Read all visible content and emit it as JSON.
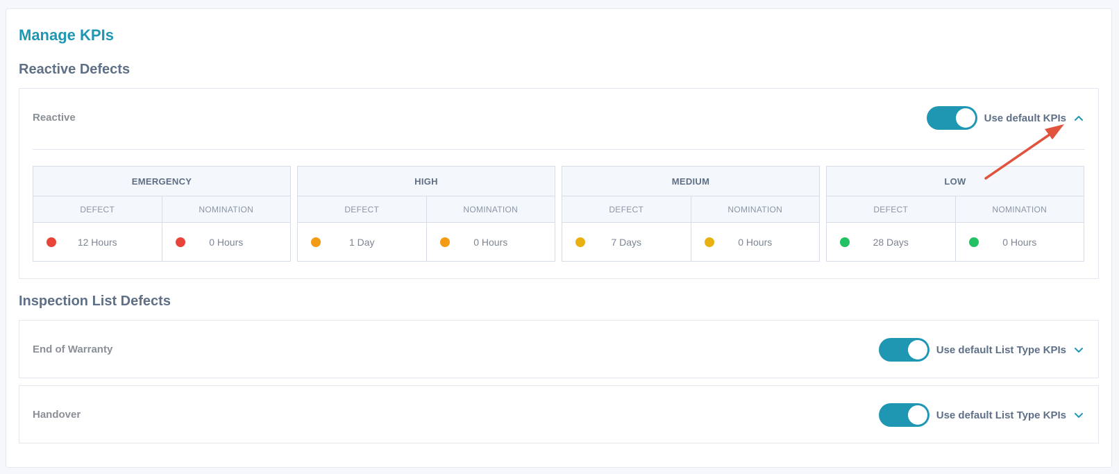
{
  "page": {
    "title": "Manage KPIs"
  },
  "reactive_section": {
    "title": "Reactive Defects",
    "panel": {
      "label": "Reactive",
      "toggle_on": true,
      "toggle_label": "Use default KPIs",
      "expanded": true,
      "groups": [
        {
          "name": "EMERGENCY",
          "defect_header": "DEFECT",
          "nomination_header": "NOMINATION",
          "defect_value": "12 Hours",
          "nomination_value": "0 Hours",
          "color": "#e8443a"
        },
        {
          "name": "HIGH",
          "defect_header": "DEFECT",
          "nomination_header": "NOMINATION",
          "defect_value": "1 Day",
          "nomination_value": "0 Hours",
          "color": "#f39b14"
        },
        {
          "name": "MEDIUM",
          "defect_header": "DEFECT",
          "nomination_header": "NOMINATION",
          "defect_value": "7 Days",
          "nomination_value": "0 Hours",
          "color": "#e8b10f"
        },
        {
          "name": "LOW",
          "defect_header": "DEFECT",
          "nomination_header": "NOMINATION",
          "defect_value": "28 Days",
          "nomination_value": "0 Hours",
          "color": "#22c164"
        }
      ]
    }
  },
  "inspection_section": {
    "title": "Inspection List Defects",
    "panels": [
      {
        "label": "End of Warranty",
        "toggle_on": true,
        "toggle_label": "Use default List Type KPIs",
        "expanded": false
      },
      {
        "label": "Handover",
        "toggle_on": true,
        "toggle_label": "Use default List Type KPIs",
        "expanded": false
      }
    ]
  },
  "colors": {
    "accent": "#1f97b3",
    "annotation_arrow": "#e0533d"
  },
  "icons": {
    "collapse": "chevron-up-icon",
    "expand": "chevron-down-icon"
  }
}
